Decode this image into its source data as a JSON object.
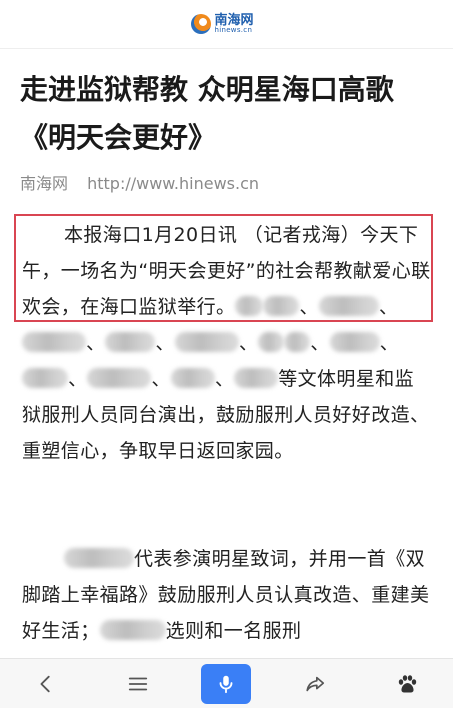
{
  "header": {
    "logo_cn": "南海网",
    "logo_en": "hinews.cn"
  },
  "article": {
    "title": "走进监狱帮教 众明星海口高歌《明天会更好》",
    "source": "南海网",
    "url": "http://www.hinews.cn",
    "p1_part1": "本报海口1月20日讯 （记者戎海）今天下午，一场名为“明天会更好”的社会帮教献爱心联欢会，在海口监狱举行。",
    "p1_sep": "、",
    "p1_deng": "等",
    "p1_part2": "文体明星和监狱服刑人员同台演出，鼓励服刑人员好好改造、重塑信心，争取早日返回家园。",
    "p2_part1": "代表参演明星致词，并用一首《双脚踏上幸福路》鼓励服刑人员认真改造、重建美好生活；",
    "p2_part2": "选则和一名服刑"
  },
  "toolbar": {
    "back_icon": "chevron-left-icon",
    "menu_icon": "hamburger-icon",
    "mic_icon": "microphone-icon",
    "share_icon": "share-arrow-icon",
    "baidu_icon": "baidu-paw-icon",
    "mic_color": "#3a7ff6"
  },
  "annotation": {
    "highlight_color": "#d94552"
  }
}
